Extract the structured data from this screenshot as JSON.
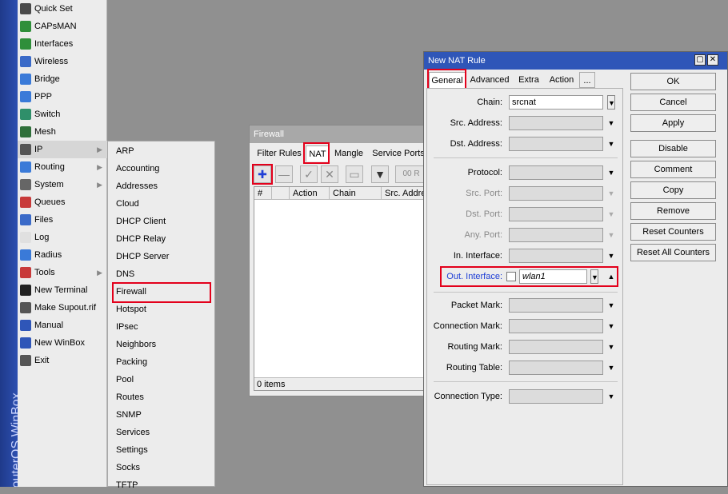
{
  "brand": "RouterOS WinBox",
  "main_menu": [
    {
      "label": "Quick Set",
      "icon": "quick-set-icon",
      "color": "#4a4a4a"
    },
    {
      "label": "CAPsMAN",
      "icon": "capsman-icon",
      "color": "#2f8f3a"
    },
    {
      "label": "Interfaces",
      "icon": "interfaces-icon",
      "color": "#2f8f3a"
    },
    {
      "label": "Wireless",
      "icon": "wireless-icon",
      "color": "#3a6ac8"
    },
    {
      "label": "Bridge",
      "icon": "bridge-icon",
      "color": "#3a7ad8"
    },
    {
      "label": "PPP",
      "icon": "ppp-icon",
      "color": "#3a7ad8"
    },
    {
      "label": "Switch",
      "icon": "switch-icon",
      "color": "#2f8f6a"
    },
    {
      "label": "Mesh",
      "icon": "mesh-icon",
      "color": "#2f6f3a"
    },
    {
      "label": "IP",
      "icon": "ip-icon",
      "color": "#555555",
      "submenu": true,
      "selected": true
    },
    {
      "label": "Routing",
      "icon": "routing-icon",
      "color": "#3a7ad8",
      "submenu": true
    },
    {
      "label": "System",
      "icon": "system-icon",
      "color": "#666666",
      "submenu": true
    },
    {
      "label": "Queues",
      "icon": "queues-icon",
      "color": "#c83a3a"
    },
    {
      "label": "Files",
      "icon": "files-icon",
      "color": "#3a6ac8"
    },
    {
      "label": "Log",
      "icon": "log-icon",
      "color": "#e0e0e0"
    },
    {
      "label": "Radius",
      "icon": "radius-icon",
      "color": "#3a7ad8"
    },
    {
      "label": "Tools",
      "icon": "tools-icon",
      "color": "#c83a3a",
      "submenu": true
    },
    {
      "label": "New Terminal",
      "icon": "terminal-icon",
      "color": "#222222"
    },
    {
      "label": "Make Supout.rif",
      "icon": "supout-icon",
      "color": "#555555"
    },
    {
      "label": "Manual",
      "icon": "manual-icon",
      "color": "#2f56b8"
    },
    {
      "label": "New WinBox",
      "icon": "winbox-icon",
      "color": "#2f56b8"
    },
    {
      "label": "Exit",
      "icon": "exit-icon",
      "color": "#555555"
    }
  ],
  "ip_submenu": [
    "ARP",
    "Accounting",
    "Addresses",
    "Cloud",
    "DHCP Client",
    "DHCP Relay",
    "DHCP Server",
    "DNS",
    "Firewall",
    "Hotspot",
    "IPsec",
    "Neighbors",
    "Packing",
    "Pool",
    "Routes",
    "SNMP",
    "Services",
    "Settings",
    "Socks",
    "TFTP"
  ],
  "firewall": {
    "title": "Firewall",
    "tabs": [
      "Filter Rules",
      "NAT",
      "Mangle",
      "Service Ports"
    ],
    "active_tab": "NAT",
    "toolbar": {
      "add": "✚",
      "remove": "—",
      "enable": "✓",
      "disable": "✕",
      "comment": "▭",
      "filter": "▼",
      "reset": "00 R"
    },
    "columns": [
      "#",
      "",
      "Action",
      "Chain",
      "Src. Address"
    ],
    "status": "0 items"
  },
  "nat_rule": {
    "title": "New NAT Rule",
    "tabs": [
      "General",
      "Advanced",
      "Extra",
      "Action",
      "..."
    ],
    "active_tab": "General",
    "fields": {
      "chain": {
        "label": "Chain:",
        "value": "srcnat"
      },
      "src_address": {
        "label": "Src. Address:",
        "value": ""
      },
      "dst_address": {
        "label": "Dst. Address:",
        "value": ""
      },
      "protocol": {
        "label": "Protocol:",
        "value": ""
      },
      "src_port": {
        "label": "Src. Port:",
        "value": ""
      },
      "dst_port": {
        "label": "Dst. Port:",
        "value": ""
      },
      "any_port": {
        "label": "Any. Port:",
        "value": ""
      },
      "in_interface": {
        "label": "In. Interface:",
        "value": ""
      },
      "out_interface": {
        "label": "Out. Interface:",
        "value": "wlan1"
      },
      "packet_mark": {
        "label": "Packet Mark:",
        "value": ""
      },
      "connection_mark": {
        "label": "Connection Mark:",
        "value": ""
      },
      "routing_mark": {
        "label": "Routing Mark:",
        "value": ""
      },
      "routing_table": {
        "label": "Routing Table:",
        "value": ""
      },
      "connection_type": {
        "label": "Connection Type:",
        "value": ""
      }
    },
    "buttons": [
      "OK",
      "Cancel",
      "Apply",
      "Disable",
      "Comment",
      "Copy",
      "Remove",
      "Reset Counters",
      "Reset All Counters"
    ]
  },
  "colors": {
    "highlight": "#e3001b",
    "title_active": "#2f56b8",
    "title_inactive": "#a8a8a8",
    "label_blue": "#1f3fd6"
  }
}
